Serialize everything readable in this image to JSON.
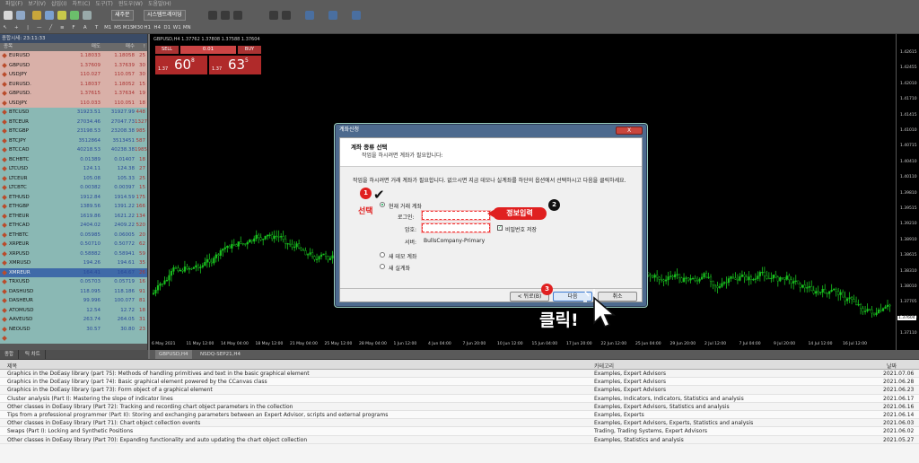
{
  "menu": [
    "파일(F)",
    "보기(V)",
    "삽입(I)",
    "차트(C)",
    "도구(T)",
    "윈도우(W)",
    "도움말(H)"
  ],
  "toolbar": {
    "new_order": "새주문",
    "auto_trading": "시스템트레이딩"
  },
  "timeframes": [
    "M1",
    "M5",
    "M15",
    "M30",
    "H1",
    "H4",
    "D1",
    "W1",
    "MN"
  ],
  "market_watch": {
    "title": "종합시세: 23:11:33",
    "columns": [
      "종목",
      "매도",
      "매수",
      "!"
    ],
    "rows": [
      {
        "symbol": "EURUSD",
        "bid": "1.18033",
        "ask": "1.18058",
        "spread": "25",
        "tone": "red"
      },
      {
        "symbol": "GBPUSD",
        "bid": "1.37609",
        "ask": "1.37639",
        "spread": "30",
        "tone": "red"
      },
      {
        "symbol": "USDJPY",
        "bid": "110.027",
        "ask": "110.057",
        "spread": "30",
        "tone": "red"
      },
      {
        "symbol": "EURUSD.",
        "bid": "1.18037",
        "ask": "1.18052",
        "spread": "15",
        "tone": "red"
      },
      {
        "symbol": "GBPUSD.",
        "bid": "1.37615",
        "ask": "1.37634",
        "spread": "19",
        "tone": "red"
      },
      {
        "symbol": "USDJPY.",
        "bid": "110.033",
        "ask": "110.051",
        "spread": "18",
        "tone": "red"
      },
      {
        "symbol": "BTCUSD",
        "bid": "31923.51",
        "ask": "31927.99",
        "spread": "448",
        "tone": "teal"
      },
      {
        "symbol": "BTCEUR",
        "bid": "27034.46",
        "ask": "27047.73",
        "spread": "1327",
        "tone": "teal"
      },
      {
        "symbol": "BTCGBP",
        "bid": "23198.53",
        "ask": "23208.38",
        "spread": "985",
        "tone": "teal"
      },
      {
        "symbol": "BTCJPY",
        "bid": "3512864",
        "ask": "3513451",
        "spread": "587",
        "tone": "teal"
      },
      {
        "symbol": "BTCCAD",
        "bid": "40218.53",
        "ask": "40238.38",
        "spread": "1985",
        "tone": "teal"
      },
      {
        "symbol": "BCHBTC",
        "bid": "0.01389",
        "ask": "0.01407",
        "spread": "18",
        "tone": "teal"
      },
      {
        "symbol": "LTCUSD",
        "bid": "124.11",
        "ask": "124.38",
        "spread": "27",
        "tone": "teal"
      },
      {
        "symbol": "LTCEUR",
        "bid": "105.08",
        "ask": "105.33",
        "spread": "25",
        "tone": "teal"
      },
      {
        "symbol": "LTCBTC",
        "bid": "0.00382",
        "ask": "0.00397",
        "spread": "15",
        "tone": "teal"
      },
      {
        "symbol": "ETHUSD",
        "bid": "1912.84",
        "ask": "1914.59",
        "spread": "175",
        "tone": "teal"
      },
      {
        "symbol": "ETHGBP",
        "bid": "1389.56",
        "ask": "1391.22",
        "spread": "166",
        "tone": "teal"
      },
      {
        "symbol": "ETHEUR",
        "bid": "1619.86",
        "ask": "1621.22",
        "spread": "134",
        "tone": "teal"
      },
      {
        "symbol": "ETHCAD",
        "bid": "2404.02",
        "ask": "2409.22",
        "spread": "520",
        "tone": "teal"
      },
      {
        "symbol": "ETHBTC",
        "bid": "0.05985",
        "ask": "0.06005",
        "spread": "20",
        "tone": "teal"
      },
      {
        "symbol": "XRPEUR",
        "bid": "0.50710",
        "ask": "0.50772",
        "spread": "62",
        "tone": "teal"
      },
      {
        "symbol": "XRPUSD",
        "bid": "0.58882",
        "ask": "0.58941",
        "spread": "59",
        "tone": "teal"
      },
      {
        "symbol": "XMRUSD",
        "bid": "194.26",
        "ask": "194.61",
        "spread": "35",
        "tone": "teal"
      },
      {
        "symbol": "XMREUR",
        "bid": "164.41",
        "ask": "164.67",
        "spread": "26",
        "tone": "sel"
      },
      {
        "symbol": "TRXUSD",
        "bid": "0.05703",
        "ask": "0.05719",
        "spread": "16",
        "tone": "teal"
      },
      {
        "symbol": "DASHUSD",
        "bid": "118.095",
        "ask": "118.186",
        "spread": "91",
        "tone": "teal"
      },
      {
        "symbol": "DASHEUR",
        "bid": "99.996",
        "ask": "100.077",
        "spread": "81",
        "tone": "teal"
      },
      {
        "symbol": "ATOMUSD",
        "bid": "12.54",
        "ask": "12.72",
        "spread": "18",
        "tone": "teal"
      },
      {
        "symbol": "AAVEUSD",
        "bid": "263.74",
        "ask": "264.05",
        "spread": "31",
        "tone": "teal"
      },
      {
        "symbol": "NEOUSD",
        "bid": "30.57",
        "ask": "30.80",
        "spread": "23",
        "tone": "teal"
      },
      {
        "symbol": "",
        "bid": "",
        "ask": "",
        "spread": "",
        "tone": "teal"
      }
    ],
    "tabs": [
      "종합",
      "틱 차트"
    ]
  },
  "chart": {
    "title": "GBPUSD,H4  1.37762 1.37808 1.37588 1.37604",
    "trade": {
      "sell": "SELL",
      "buy": "BUY",
      "lots": "0.01",
      "sell_pre": "1.37",
      "sell_big": "60",
      "sell_sup": "8",
      "buy_pre": "1.37",
      "buy_big": "63",
      "buy_sup": "5"
    },
    "yticks": [
      "1.42615",
      "1.42455",
      "1.42010",
      "1.41710",
      "1.41415",
      "1.41010",
      "1.40715",
      "1.40410",
      "1.40110",
      "1.39810",
      "1.39515",
      "1.39210",
      "1.38910",
      "1.38615",
      "1.38310",
      "1.38010",
      "1.37705",
      "1.37410",
      "1.37110"
    ],
    "current_price": "1.37604",
    "xticks": [
      "6 May 2021",
      "11 May 12:00",
      "14 May 04:00",
      "18 May 12:00",
      "21 May 04:00",
      "25 May 12:00",
      "28 May 04:00",
      "1 Jun 12:00",
      "4 Jun 04:00",
      "7 Jun 20:00",
      "10 Jun 12:00",
      "15 Jun 04:00",
      "17 Jun 20:00",
      "22 Jun 12:00",
      "25 Jun 04:00",
      "29 Jun 20:00",
      "2 Jul 12:00",
      "7 Jul 04:00",
      "9 Jul 20:00",
      "14 Jul 12:00",
      "16 Jul 12:00"
    ],
    "tabs": [
      "GBPUSD,H4",
      "NSDQ-SEP21,H4"
    ]
  },
  "news": {
    "columns": {
      "title": "제목",
      "category": "카테고리",
      "date": "날짜"
    },
    "rows": [
      {
        "title": "Graphics in the DoEasy library (part 75): Methods of handling primitives and text in the basic graphical element",
        "category": "Examples, Expert Advisors",
        "date": "2021.07.06"
      },
      {
        "title": "Graphics in the DoEasy library (part 74): Basic graphical element powered by the CCanvas class",
        "category": "Examples, Expert Advisors",
        "date": "2021.06.28"
      },
      {
        "title": "Graphics in the DoEasy library (part 73): Form object of a graphical element",
        "category": "Examples, Expert Advisors",
        "date": "2021.06.23"
      },
      {
        "title": "Cluster analysis (Part I): Mastering the slope of indicator lines",
        "category": "Examples, Indicators, Indicators, Statistics and analysis",
        "date": "2021.06.17"
      },
      {
        "title": "Other classes in DoEasy library (Part 72): Tracking and recording chart object parameters in the collection",
        "category": "Examples, Expert Advisors, Statistics and analysis",
        "date": "2021.06.16"
      },
      {
        "title": "Tips from a professional programmer (Part II): Storing and exchanging parameters between an Expert Advisor, scripts and external programs",
        "category": "Examples, Experts",
        "date": "2021.06.14"
      },
      {
        "title": "Other classes in DoEasy library (Part 71): Chart object collection events",
        "category": "Examples, Expert Advisors, Experts, Statistics and analysis",
        "date": "2021.06.03"
      },
      {
        "title": "Swaps (Part I): Locking and Synthetic Positions",
        "category": "Trading, Trading Systems, Expert Advisors",
        "date": "2021.06.02"
      },
      {
        "title": "Other classes in DoEasy library (Part 70): Expanding functionality and auto updating the chart object collection",
        "category": "Examples, Statistics and analysis",
        "date": "2021.05.27"
      }
    ]
  },
  "dialog": {
    "title": "계좌신청",
    "close": "X",
    "heading": "계좌 종류 선택",
    "subheading": "작업을 하시려면 계좌가 필요합니다:",
    "description": "작업을 하시려면 거래 계좌가 필요합니다. 없으시면 지금 데모나 실계좌를 하단의 옵션에서 선택하시고 다음을 클릭하세요.",
    "existing_account": "현재 거래 계좌",
    "login_label": "로그인:",
    "password_label": "암호:",
    "save_password": "비밀번호 저장",
    "server_label": "서버:",
    "server_value": "BullsCompany-Primary",
    "new_demo": "새 데모 계좌",
    "new_real": "새 실계좌",
    "back": "< 뒤로(B)",
    "next": "다음",
    "cancel": "취소"
  },
  "annotations": {
    "n1": "1",
    "n2": "2",
    "n3": "3",
    "select": "선택",
    "check": "✔",
    "input": "정보입력",
    "click": "클릭!"
  }
}
